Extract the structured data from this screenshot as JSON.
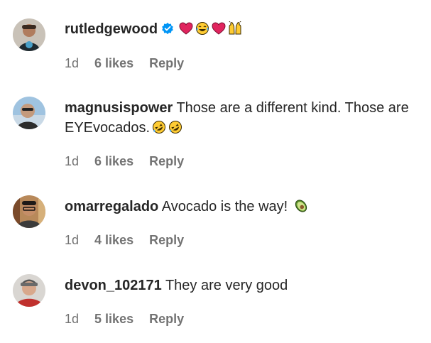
{
  "comments": [
    {
      "username": "rutledgewood",
      "verified": true,
      "text": "",
      "emojis": [
        "red-heart-emoji",
        "tears-of-joy-emoji",
        "red-heart-emoji",
        "raising-hands-emoji"
      ],
      "time": "1d",
      "likes": "6 likes",
      "reply": "Reply"
    },
    {
      "username": "magnusispower",
      "verified": false,
      "text": "Those are a different kind. Those are EYEvocados.",
      "emojis": [
        "rolling-on-floor-laughing-emoji",
        "rolling-on-floor-laughing-emoji"
      ],
      "time": "1d",
      "likes": "6 likes",
      "reply": "Reply"
    },
    {
      "username": "omarregalado",
      "verified": false,
      "text": "Avocado is the way!",
      "emojis": [
        "avocado-emoji"
      ],
      "time": "1d",
      "likes": "4 likes",
      "reply": "Reply"
    },
    {
      "username": "devon_102171",
      "verified": false,
      "text": "They are very good",
      "emojis": [],
      "time": "1d",
      "likes": "5 likes",
      "reply": "Reply"
    }
  ],
  "colors": {
    "text": "#262626",
    "secondary": "#737373",
    "verified_blue": "#0095f6",
    "heart_red": "#e0245e"
  }
}
